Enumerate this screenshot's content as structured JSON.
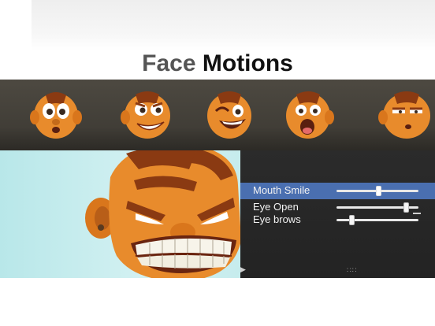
{
  "header": {
    "title_light": "Face",
    "title_bold": "Motions"
  },
  "expression_strip": {
    "icons": [
      "surprised-face-icon",
      "grinning-face-icon",
      "laughing-face-icon",
      "shocked-face-icon",
      "sleepy-face-icon"
    ]
  },
  "editor": {
    "controls": [
      {
        "label": "Mouth Smile",
        "value": 0.5,
        "selected": true
      },
      {
        "label": "Eye Open",
        "value": 0.85,
        "selected": false
      },
      {
        "label": "Eye brows",
        "value": 0.18,
        "selected": false
      }
    ],
    "play_icon": "play-icon",
    "handle_icon": "grip-icon",
    "colors": {
      "accent": "#4a6fb0",
      "panel": "#262626",
      "skin": "#e88b2c",
      "stripe": "#8a3a12",
      "sky": "#c6eced"
    }
  }
}
